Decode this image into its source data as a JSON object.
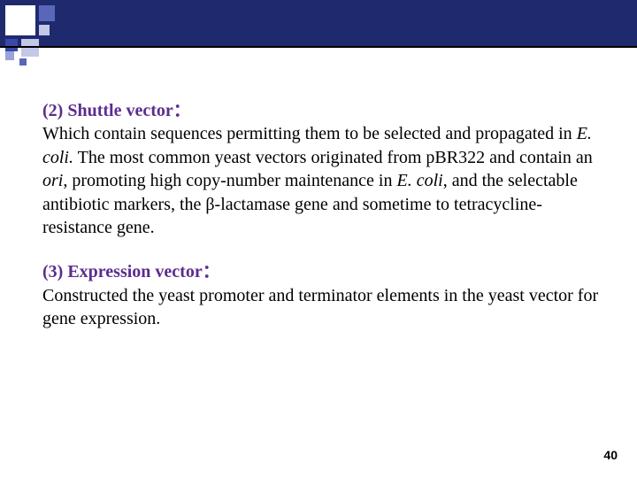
{
  "sections": [
    {
      "heading": "(2) Shuttle vector：",
      "body_html": "Which contain sequences permitting them to be selected and propagated in <span class=\"italic\">E. coli.</span> The most common yeast vectors originated from pBR322 and contain an <span class=\"italic\">ori</span>, promoting high copy-number maintenance in <span class=\"italic\">E. coli</span>, and the selectable antibiotic markers, the β-lactamase gene and sometime to tetracycline-resistance gene."
    },
    {
      "heading": "(3) Expression vector：",
      "body_html": "Constructed the yeast promoter and terminator elements in the yeast vector for gene expression."
    }
  ],
  "page_number": "40",
  "colors": {
    "heading": "#5b2d8e",
    "band": "#1f2a6e"
  }
}
